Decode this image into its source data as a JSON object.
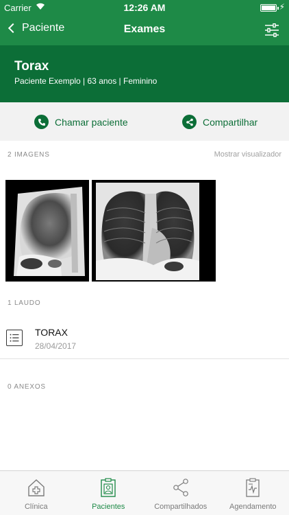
{
  "status_bar": {
    "carrier": "Carrier",
    "time": "12:26 AM"
  },
  "nav": {
    "back_label": "Paciente",
    "title": "Exames"
  },
  "header": {
    "exam_name": "Torax",
    "patient_info": "Paciente Exemplo | 63 anos | Feminino"
  },
  "actions": {
    "call_label": "Chamar paciente",
    "share_label": "Compartilhar"
  },
  "images": {
    "section_label": "2 IMAGENS",
    "viewer_link": "Mostrar visualizador"
  },
  "reports": {
    "section_label": "1 LAUDO",
    "items": [
      {
        "name": "TORAX",
        "date": "28/04/2017"
      }
    ]
  },
  "attachments": {
    "section_label": "0 ANEXOS"
  },
  "tabs": [
    {
      "label": "Clínica",
      "icon": "clinic-icon",
      "active": false
    },
    {
      "label": "Pacientes",
      "icon": "patients-icon",
      "active": true
    },
    {
      "label": "Compartilhados",
      "icon": "share-icon",
      "active": false
    },
    {
      "label": "Agendamento",
      "icon": "schedule-icon",
      "active": false
    }
  ],
  "colors": {
    "nav_green": "#1e8a47",
    "header_green": "#0c6e37",
    "action_bg": "#f2f2f2"
  }
}
